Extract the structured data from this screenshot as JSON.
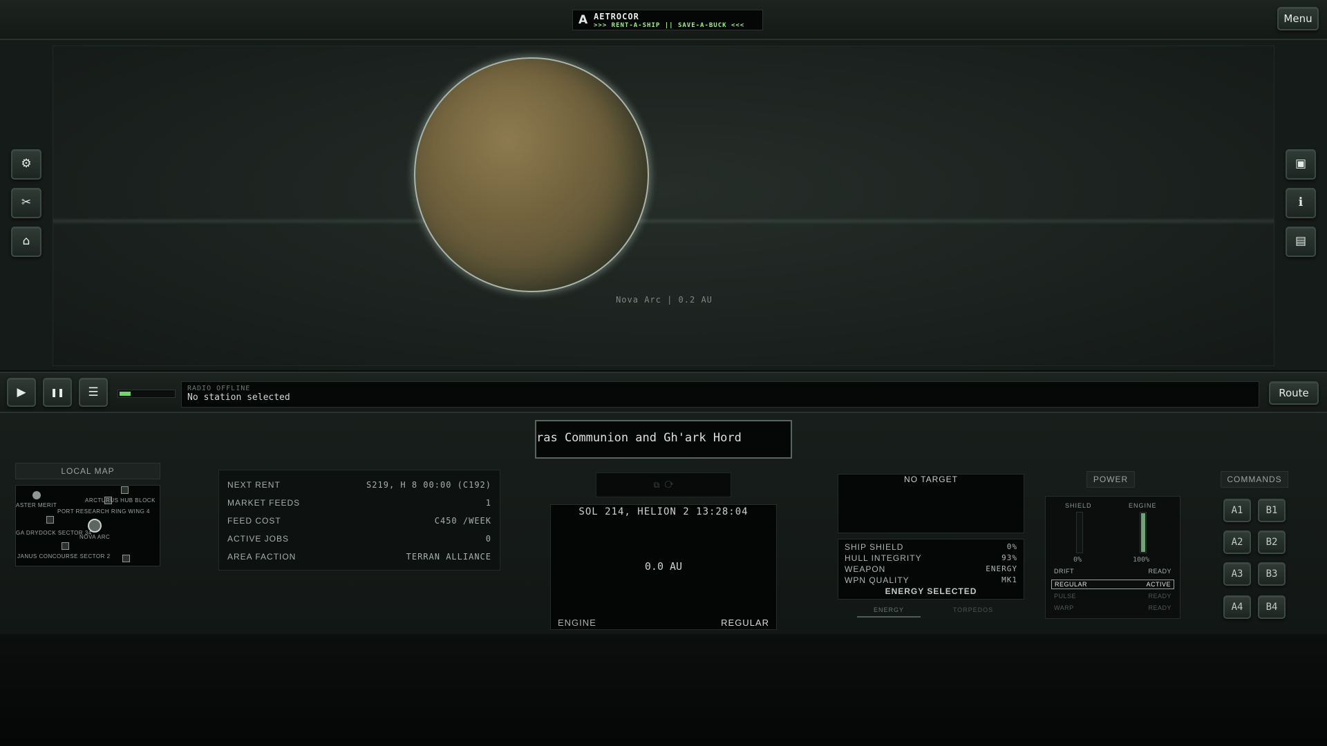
{
  "header": {
    "brand_logo": "A",
    "brand_name": "AETROCOR",
    "brand_slogan": ">>> RENT-A-SHIP || SAVE-A-BUCK <<<",
    "menu_label": "Menu"
  },
  "viewport": {
    "planet_label": "Nova Arc | 0.2 AU",
    "left_buttons": [
      {
        "icon": "gear-icon",
        "glyph": "⚙"
      },
      {
        "icon": "tools-icon",
        "glyph": "✂"
      },
      {
        "icon": "shop-icon",
        "glyph": "⌂"
      }
    ],
    "right_buttons": [
      {
        "icon": "cargo-icon",
        "glyph": "▣"
      },
      {
        "icon": "info-icon",
        "glyph": "ℹ"
      },
      {
        "icon": "chat-icon",
        "glyph": "▤"
      }
    ]
  },
  "radio": {
    "play_glyph": "▶",
    "pause_glyph": "❚❚",
    "list_glyph": "☰",
    "progress": 0.2,
    "status": "RADIO OFFLINE",
    "station": "No station selected",
    "route_label": "Route"
  },
  "ticker": {
    "text": "ras Communion and Gh'ark Hord"
  },
  "local_map": {
    "title": "LOCAL MAP",
    "labels": [
      "ASTER MERIT",
      "ARCTURUS HUB BLOCK",
      "PORT RESEARCH RING WING 4",
      "GA DRYDOCK SECTOR 34",
      "NOVA ARC",
      "JANUS CONCOURSE SECTOR 2"
    ]
  },
  "stats": {
    "rows": [
      {
        "label": "NEXT RENT",
        "value": "S219, H 8 00:00 (C192)"
      },
      {
        "label": "MARKET FEEDS",
        "value": "1"
      },
      {
        "label": "FEED COST",
        "value": "C450 /WEEK"
      },
      {
        "label": "ACTIVE JOBS",
        "value": "0"
      },
      {
        "label": "AREA FACTION",
        "value": "TERRAN ALLIANCE"
      }
    ]
  },
  "nav": {
    "top_glyph": "⧉ ⟳",
    "date": "SOL 214, HELION 2 13:28:04",
    "distance": "0.0 AU",
    "engine_label": "ENGINE",
    "engine_mode": "REGULAR"
  },
  "combat": {
    "target": "NO TARGET",
    "rows": [
      {
        "label": "SHIP SHIELD",
        "value": "0%"
      },
      {
        "label": "HULL INTEGRITY",
        "value": "93%"
      },
      {
        "label": "WEAPON",
        "value": "ENERGY"
      },
      {
        "label": "WPN QUALITY",
        "value": "MK1"
      }
    ],
    "selected": "ENERGY SELECTED",
    "tabs": [
      "ENERGY",
      "TORPEDOS"
    ]
  },
  "power": {
    "title": "POWER",
    "shield_label": "SHIELD",
    "engine_label": "ENGINE",
    "shield_level": 0,
    "engine_level": 1.0,
    "shield_value": "0%",
    "engine_value": "100%",
    "modes": [
      {
        "name": "DRIFT",
        "state": "READY"
      },
      {
        "name": "REGULAR",
        "state": "ACTIVE"
      },
      {
        "name": "PULSE",
        "state": "READY"
      },
      {
        "name": "WARP",
        "state": "READY"
      }
    ]
  },
  "commands": {
    "title": "COMMANDS",
    "buttons": [
      "A1",
      "B1",
      "A2",
      "B2",
      "A3",
      "B3",
      "A4",
      "B4"
    ]
  },
  "colors": {
    "accent_green": "#72d46a",
    "slogan_green": "#9ff08b",
    "panel_bg": "#050706"
  }
}
